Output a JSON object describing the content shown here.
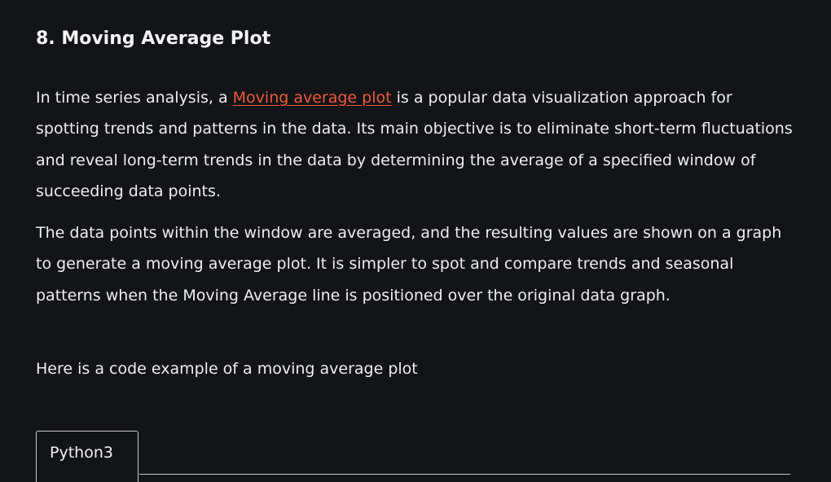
{
  "article": {
    "heading": "8. Moving Average Plot",
    "paragraph1": {
      "before_link": "In time series analysis, a ",
      "link_text": "Moving average plot",
      "after_link": " is a popular data visualization approach for spotting trends and patterns in the data. Its main objective is to eliminate short-term fluctuations and reveal long-term trends in the data by determining the average of a specified window of succeeding data points."
    },
    "paragraph2": "The data points within the window are averaged, and the resulting values are shown on a graph to generate a moving average plot. It is simpler to spot and compare trends and seasonal patterns when the Moving Average line is positioned over the original data graph.",
    "paragraph3": "Here is a code example of a moving average plot"
  },
  "code_tabs": {
    "items": [
      {
        "label": "Python3",
        "active": true
      }
    ]
  },
  "colors": {
    "background": "#131417",
    "text": "#eeeeee",
    "link": "#ef5a3a",
    "tab_border": "#c9c9c9"
  }
}
